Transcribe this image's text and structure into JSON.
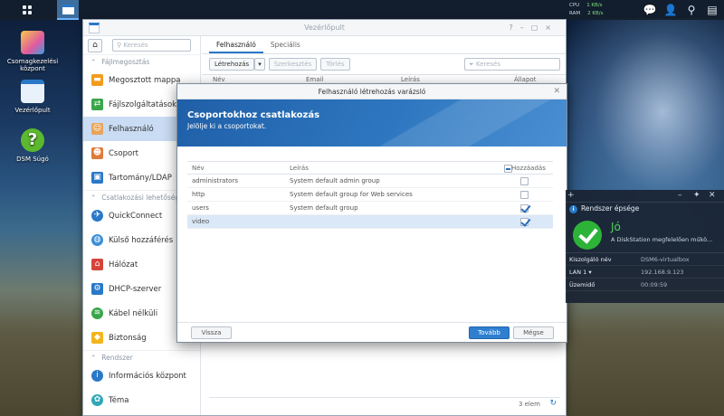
{
  "taskbar": {
    "resource": {
      "cpu_label": "CPU",
      "cpu_value": "1 KB/s",
      "ram_label": "RAM",
      "ram_value": "2 KB/s"
    }
  },
  "desktop": {
    "icons": [
      {
        "label": "Csomagkezelési központ"
      },
      {
        "label": "Vezérlőpult"
      },
      {
        "label": "DSM Súgó"
      }
    ]
  },
  "control_panel": {
    "title": "Vezérlőpult",
    "search_placeholder": "Keresés",
    "sections": [
      {
        "label": "Fájlmegosztás"
      },
      {
        "label": "Csatlakozási lehetőség"
      },
      {
        "label": "Rendszer"
      }
    ],
    "items": [
      {
        "label": "Megosztott mappa"
      },
      {
        "label": "Fájlszolgáltatások"
      },
      {
        "label": "Felhasználó"
      },
      {
        "label": "Csoport"
      },
      {
        "label": "Tartomány/LDAP"
      },
      {
        "label": "QuickConnect"
      },
      {
        "label": "Külső hozzáférés"
      },
      {
        "label": "Hálózat"
      },
      {
        "label": "DHCP-szerver"
      },
      {
        "label": "Kábel nélküli"
      },
      {
        "label": "Biztonság"
      },
      {
        "label": "Információs központ"
      },
      {
        "label": "Téma"
      }
    ],
    "tabs": [
      "Felhasználó",
      "Speciális"
    ],
    "toolbar": {
      "create": "Létrehozás",
      "edit": "Szerkesztés",
      "delete": "Törlés",
      "filter_placeholder": "Keresés"
    },
    "columns": [
      "Név",
      "Email",
      "Leírás",
      "Állapot"
    ],
    "footer_count": "3 elem"
  },
  "wizard": {
    "title": "Felhasználó létrehozás varázsló",
    "heading": "Csoportokhoz csatlakozás",
    "subheading": "Jelölje ki a csoportokat.",
    "columns": {
      "name": "Név",
      "description": "Leírás",
      "add": "Hozzáadás"
    },
    "rows": [
      {
        "name": "administrators",
        "description": "System default admin group",
        "checked": false
      },
      {
        "name": "http",
        "description": "System default group for Web services",
        "checked": false
      },
      {
        "name": "users",
        "description": "System default group",
        "checked": true
      },
      {
        "name": "video",
        "description": "",
        "checked": true
      }
    ],
    "buttons": {
      "back": "Vissza",
      "next": "Tovább",
      "cancel": "Mégse"
    }
  },
  "widget": {
    "title": "Rendszer épsége",
    "status": "Jó",
    "message": "A DiskStation megfelelően műkö...",
    "rows": [
      {
        "key": "Kiszolgáló név",
        "value": "DSM6-virtualbox"
      },
      {
        "key": "LAN 1 ▾",
        "value": "192.168.9.123"
      },
      {
        "key": "Üzemidő",
        "value": "00:09:59"
      }
    ]
  }
}
